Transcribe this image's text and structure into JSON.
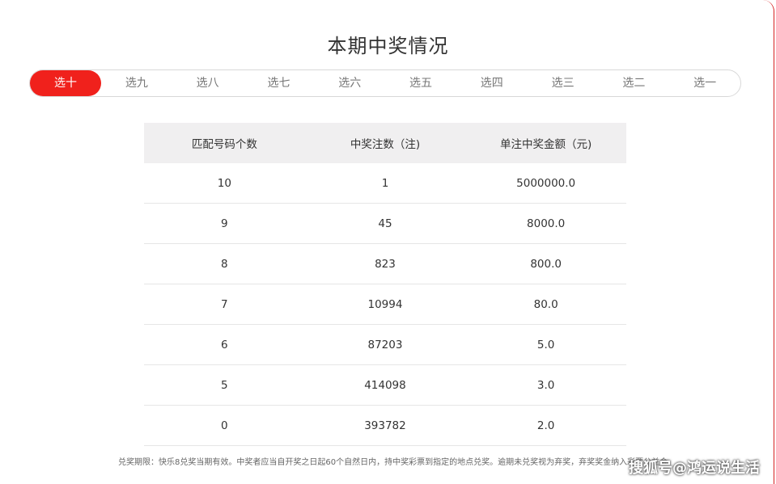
{
  "page": {
    "title": "本期中奖情况"
  },
  "tabs": [
    {
      "label": "选十",
      "active": true
    },
    {
      "label": "选九",
      "active": false
    },
    {
      "label": "选八",
      "active": false
    },
    {
      "label": "选七",
      "active": false
    },
    {
      "label": "选六",
      "active": false
    },
    {
      "label": "选五",
      "active": false
    },
    {
      "label": "选四",
      "active": false
    },
    {
      "label": "选三",
      "active": false
    },
    {
      "label": "选二",
      "active": false
    },
    {
      "label": "选一",
      "active": false
    }
  ],
  "table": {
    "headers": [
      "匹配号码个数",
      "中奖注数（注)",
      "单注中奖金额（元)"
    ],
    "rows": [
      [
        "10",
        "1",
        "5000000.0"
      ],
      [
        "9",
        "45",
        "8000.0"
      ],
      [
        "8",
        "823",
        "800.0"
      ],
      [
        "7",
        "10994",
        "80.0"
      ],
      [
        "6",
        "87203",
        "5.0"
      ],
      [
        "5",
        "414098",
        "3.0"
      ],
      [
        "0",
        "393782",
        "2.0"
      ]
    ]
  },
  "footnote": "兑奖期限：快乐8兑奖当期有效。中奖者应当自开奖之日起60个自然日内，持中奖彩票到指定的地点兑奖。逾期未兑奖视为弃奖，弃奖奖金纳入彩票公益金",
  "watermark": "搜狐号@鸿运说生活",
  "colors": {
    "accent": "#f0211c",
    "header_bg": "#f0eff0",
    "border": "#d8d8d8"
  }
}
